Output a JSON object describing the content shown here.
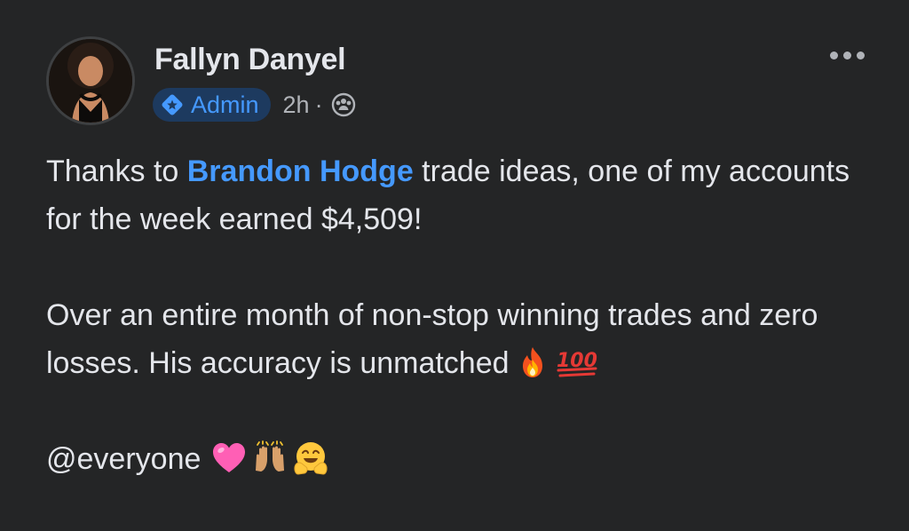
{
  "post": {
    "author": {
      "name": "Fallyn Danyel",
      "role_badge": "Admin"
    },
    "time": "2h",
    "separator": "·",
    "audience_icon": "group-icon",
    "more_icon": "more-horizontal-icon",
    "body": {
      "p1_before": "Thanks to ",
      "p1_mention": "Brandon Hodge",
      "p1_after": " trade ideas, one of my accounts for the week earned $4,509!",
      "p2_text": "Over an entire month of non-stop winning trades and zero losses. His accuracy is unmatched",
      "p2_emojis": [
        "fire-emoji",
        "hundred-points-emoji"
      ],
      "p3_text": "@everyone",
      "p3_emojis": [
        "pink-heart-emoji",
        "raising-hands-emoji",
        "hugging-face-emoji"
      ]
    }
  },
  "colors": {
    "background": "#242526",
    "text_primary": "#e4e6eb",
    "text_secondary": "#b0b3b8",
    "link_blue": "#4599ff",
    "badge_bg": "#1d3a5f"
  }
}
